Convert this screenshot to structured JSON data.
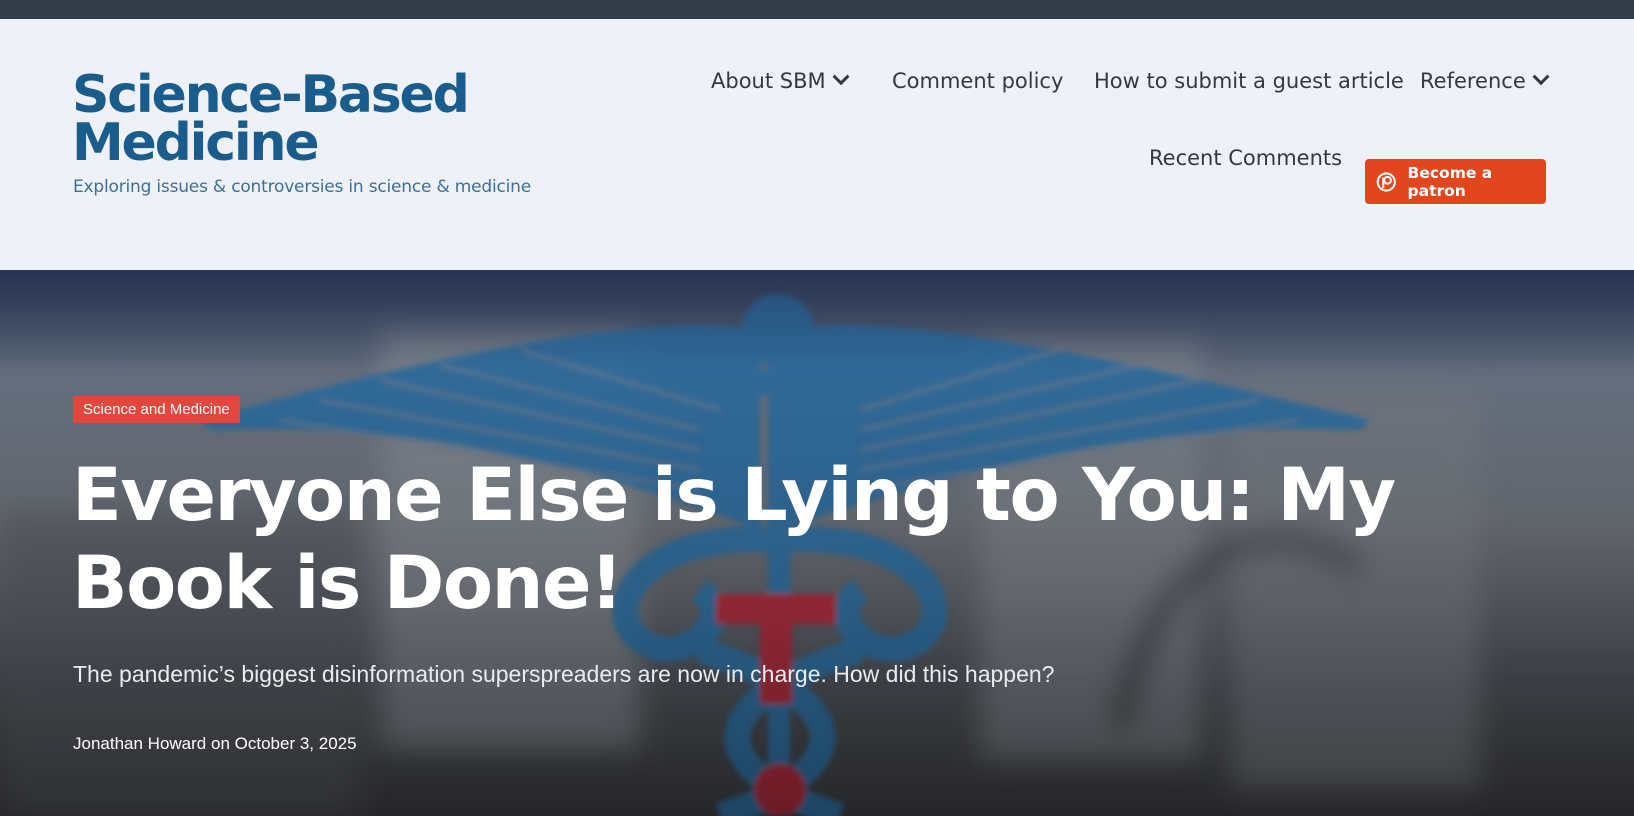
{
  "header": {
    "logo": {
      "line1": "Science-Based",
      "line2": "Medicine",
      "tagline": "Exploring issues & controversies in science & medicine"
    },
    "nav": {
      "about": "About SBM",
      "comment_policy": "Comment policy",
      "guest_article": "How to submit a guest article",
      "reference": "Reference",
      "recent_comments": "Recent Comments",
      "patron_button": "Become a patron"
    }
  },
  "hero": {
    "category": "Science and Medicine",
    "title": "Everyone Else is Lying to You: My Book is Done!",
    "subtitle": "The pandemic’s biggest disinformation superspreaders are now in charge. How did this happen?",
    "author": "Jonathan Howard",
    "date_prefix": "on",
    "date": "October 3, 2025"
  },
  "colors": {
    "topbar": "#323d49",
    "header_bg": "#eef2f8",
    "logo_blue": "#1a5d8c",
    "patron_orange": "#e1461f",
    "category_red": "#e2473d",
    "caduceus_blue": "#2e6fa3",
    "cross_red": "#b02a3a"
  },
  "icons": {
    "dropdown": "chevron-down-icon",
    "patreon": "patreon-icon",
    "hero_image": "caduceus-icon"
  }
}
